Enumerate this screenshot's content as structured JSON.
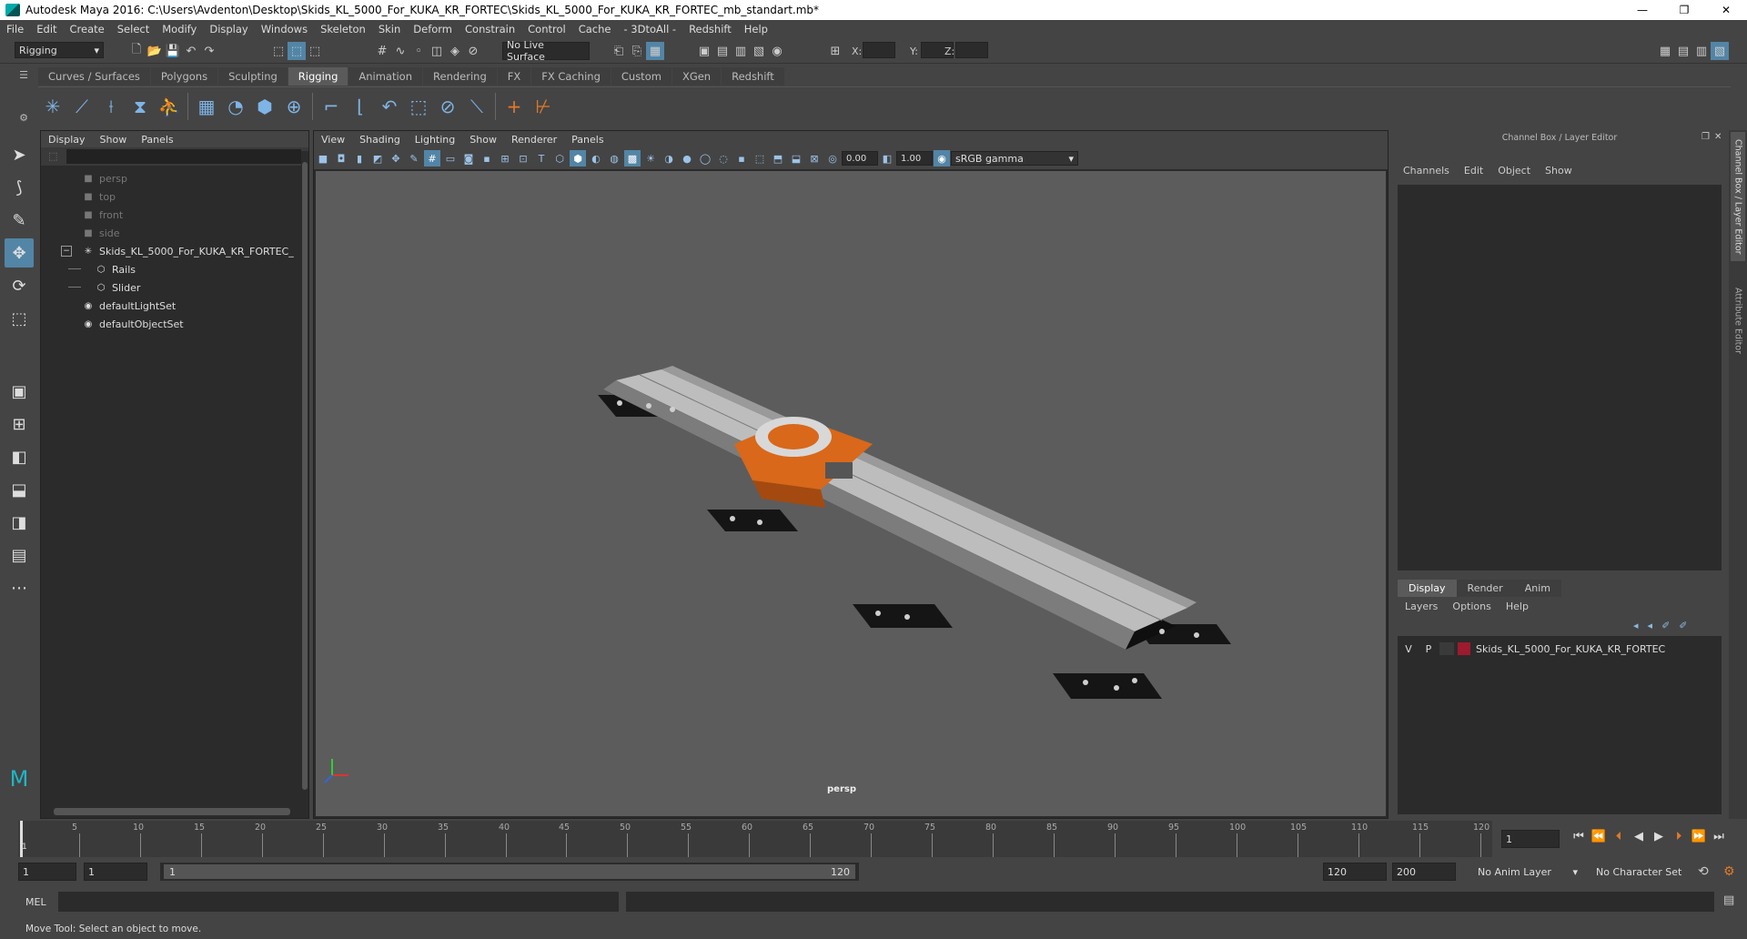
{
  "window": {
    "title": "Autodesk Maya 2016: C:\\Users\\Avdenton\\Desktop\\Skids_KL_5000_For_KUKA_KR_FORTEC\\Skids_KL_5000_For_KUKA_KR_FORTEC_mb_standart.mb*",
    "controls": [
      "—",
      "❐",
      "✕"
    ]
  },
  "menubar": [
    "File",
    "Edit",
    "Create",
    "Select",
    "Modify",
    "Display",
    "Windows",
    "Skeleton",
    "Skin",
    "Deform",
    "Constrain",
    "Control",
    "Cache",
    "- 3DtoAll -",
    "Redshift",
    "Help"
  ],
  "statusline": {
    "menuset": "Rigging",
    "live_surface": "No Live Surface",
    "x_label": "X:",
    "y_label": "Y:",
    "z_label": "Z:"
  },
  "shelf_tabs": [
    "Curves / Surfaces",
    "Polygons",
    "Sculpting",
    "Rigging",
    "Animation",
    "Rendering",
    "FX",
    "FX Caching",
    "Custom",
    "XGen",
    "Redshift"
  ],
  "shelf_active": "Rigging",
  "outliner": {
    "menu": [
      "Display",
      "Show",
      "Panels"
    ],
    "items": [
      {
        "label": "persp",
        "icon": "camera-icon",
        "dim": true,
        "indent": 0
      },
      {
        "label": "top",
        "icon": "camera-icon",
        "dim": true,
        "indent": 0
      },
      {
        "label": "front",
        "icon": "camera-icon",
        "dim": true,
        "indent": 0
      },
      {
        "label": "side",
        "icon": "camera-icon",
        "dim": true,
        "indent": 0
      },
      {
        "label": "Skids_KL_5000_For_KUKA_KR_FORTEC_",
        "icon": "joint-icon",
        "dim": false,
        "indent": 0,
        "expand": "−"
      },
      {
        "label": "Rails",
        "icon": "mesh-icon",
        "dim": false,
        "indent": 1
      },
      {
        "label": "Slider",
        "icon": "mesh-icon",
        "dim": false,
        "indent": 1
      },
      {
        "label": "defaultLightSet",
        "icon": "set-icon",
        "dim": false,
        "indent": 0
      },
      {
        "label": "defaultObjectSet",
        "icon": "set-icon",
        "dim": false,
        "indent": 0
      }
    ]
  },
  "viewport": {
    "menu": [
      "View",
      "Shading",
      "Lighting",
      "Show",
      "Renderer",
      "Panels"
    ],
    "exposure": "0.00",
    "gamma": "1.00",
    "color_space": "sRGB gamma",
    "camera_label": "persp"
  },
  "channel_box": {
    "title": "Channel Box / Layer Editor",
    "menu": [
      "Channels",
      "Edit",
      "Object",
      "Show"
    ],
    "layer_tabs": [
      "Display",
      "Render",
      "Anim"
    ],
    "layer_menu": [
      "Layers",
      "Options",
      "Help"
    ],
    "layer": {
      "v": "V",
      "p": "P",
      "name": "Skids_KL_5000_For_KUKA_KR_FORTEC",
      "color": "#9e1a2e"
    },
    "side_tabs": [
      "Channel Box / Layer Editor",
      "Attribute Editor"
    ]
  },
  "timeline": {
    "ticks": [
      5,
      10,
      15,
      20,
      25,
      30,
      35,
      40,
      45,
      50,
      55,
      60,
      65,
      70,
      75,
      80,
      85,
      90,
      95,
      100,
      105,
      110,
      115,
      120
    ],
    "current_frame": "1",
    "start_marker": "1"
  },
  "range": {
    "start": "1",
    "playback_start": "1",
    "slider_start": "1",
    "slider_end": "120",
    "playback_end": "120",
    "end": "200",
    "anim_layer": "No Anim Layer",
    "character_set": "No Character Set"
  },
  "command": {
    "label": "MEL"
  },
  "help_line": "Move Tool: Select an object to move.",
  "colors": {
    "accent": "#5285a6",
    "orange": "#e06a1a",
    "rail": "#bdbdbd"
  }
}
